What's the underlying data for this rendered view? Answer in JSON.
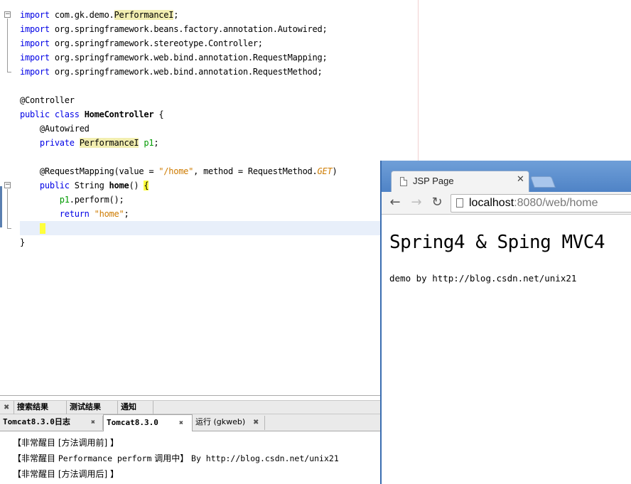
{
  "editor": {
    "lines": {
      "l1_kw": "import",
      "l1_pkg": " com.gk.demo.",
      "l1_cls": "PerformanceI",
      "l1_end": ";",
      "l2_kw": "import",
      "l2_rest": " org.springframework.beans.factory.annotation.Autowired;",
      "l3_kw": "import",
      "l3_rest": " org.springframework.stereotype.Controller;",
      "l4_kw": "import",
      "l4_rest": " org.springframework.web.bind.annotation.RequestMapping;",
      "l5_kw": "import",
      "l5_rest": " org.springframework.web.bind.annotation.RequestMethod;",
      "l7": "@Controller",
      "l8_kw1": "public",
      "l8_kw2": " class ",
      "l8_name": "HomeController",
      "l8_end": " {",
      "l9": "    @Autowired",
      "l10_kw": "    private ",
      "l10_type": "PerformanceI",
      "l10_var": " p1",
      "l10_end": ";",
      "l12_a": "    @RequestMapping(value = ",
      "l12_str": "\"/home\"",
      "l12_b": ", method = RequestMethod.",
      "l12_enum": "GET",
      "l12_c": ")",
      "l13_kw": "    public",
      "l13_a": " String ",
      "l13_name": "home",
      "l13_b": "() ",
      "l13_brace": "{",
      "l14_var": "        p1",
      "l14_rest": ".perform();",
      "l15_kw": "        return ",
      "l15_str": "\"home\"",
      "l15_end": ";",
      "l16": "    }",
      "l17": "}"
    }
  },
  "panel": {
    "tabs_top": [
      {
        "label": "搜索结果"
      },
      {
        "label": "测试结果"
      },
      {
        "label": "通知"
      }
    ],
    "tabs_bottom": [
      {
        "label": "Tomcat8.3.0日志"
      },
      {
        "label": "Tomcat8.3.0"
      },
      {
        "label": "运行 (gkweb)"
      }
    ],
    "output": {
      "line1": "【非常醒目 [方法调用前] 】",
      "line2_a": "【非常醒目 ",
      "line2_mono": "Performance perform",
      "line2_b": " 调用中】 ",
      "line2_mono2": "By http://blog.csdn.net/unix21",
      "line3": "【非常醒目 [方法调用后] 】"
    },
    "close_glyph": "✖"
  },
  "browser": {
    "tab_title": "JSP Page",
    "tab_close": "✕",
    "back_icon": "←",
    "forward_icon": "→",
    "reload_icon": "↻",
    "url_host": "localhost",
    "url_rest": ":8080/web/home",
    "heading": "Spring4 & Sping MVC4",
    "subtext": "demo by http://blog.csdn.net/unix21"
  }
}
